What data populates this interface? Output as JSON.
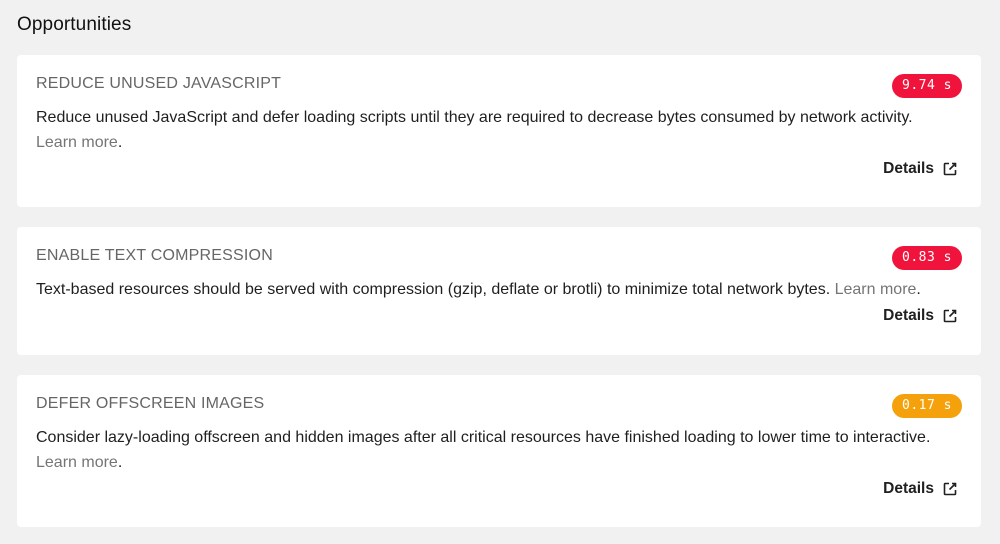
{
  "section": {
    "title": "Opportunities"
  },
  "opportunities": [
    {
      "title": "REDUCE UNUSED JAVASCRIPT",
      "savings": "9.74 s",
      "severity_color": "#f0143c",
      "description": "Reduce unused JavaScript and defer loading scripts until they are required to decrease bytes consumed by network activity.",
      "learn_more": "Learn more",
      "details_label": "Details",
      "details_icon": "external-link-icon"
    },
    {
      "title": "ENABLE TEXT COMPRESSION",
      "savings": "0.83 s",
      "severity_color": "#f0143c",
      "description": "Text-based resources should be served with compression (gzip, deflate or brotli) to minimize total network bytes.",
      "learn_more": "Learn more",
      "details_label": "Details",
      "details_icon": "external-link-icon"
    },
    {
      "title": "DEFER OFFSCREEN IMAGES",
      "savings": "0.17 s",
      "severity_color": "#f4a10c",
      "description": "Consider lazy-loading offscreen and hidden images after all critical resources have finished loading to lower time to interactive.",
      "learn_more": "Learn more",
      "details_label": "Details",
      "details_icon": "external-link-icon"
    }
  ]
}
